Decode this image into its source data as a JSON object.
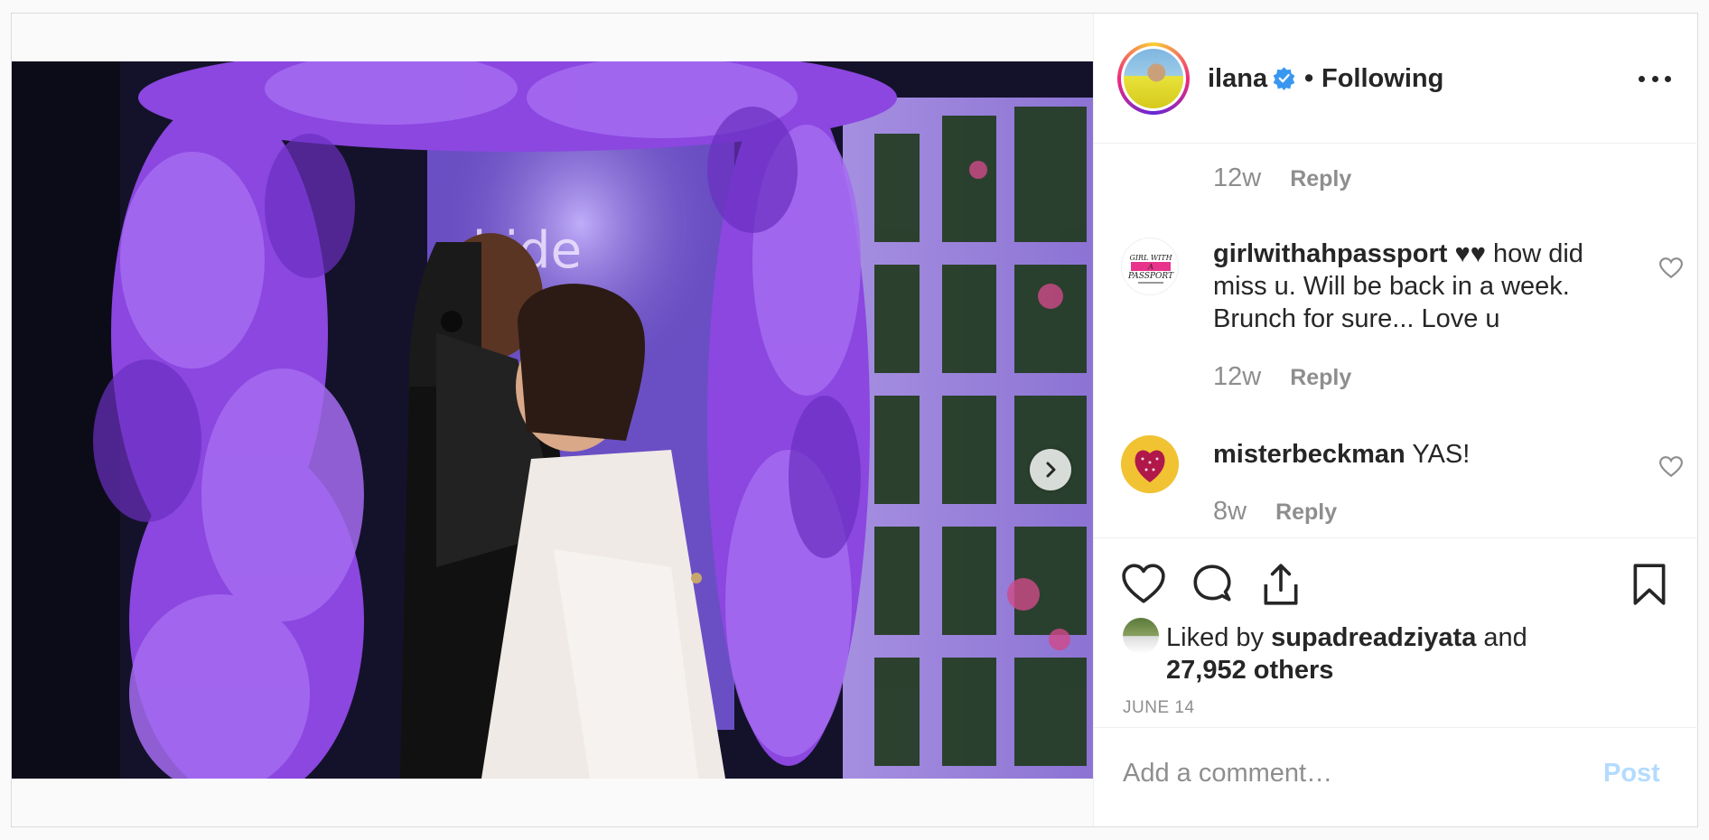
{
  "post": {
    "header": {
      "username": "ilana",
      "separator": "•",
      "follow_status": "Following",
      "verified": true
    },
    "comments": [
      {
        "id": "c0",
        "username": "",
        "text": "",
        "time": "12w",
        "reply_label": "Reply"
      },
      {
        "id": "c1",
        "username": "girlwithahpassport",
        "text": "♥♥ how did miss u. Will be back in a week. Brunch for sure... Love u",
        "time": "12w",
        "reply_label": "Reply",
        "avatar_text": "GIRL WITH A PASSPORT"
      },
      {
        "id": "c2",
        "username": "misterbeckman",
        "text": "YAS!",
        "time": "8w",
        "reply_label": "Reply"
      }
    ],
    "actions": {
      "icons": [
        "heart-icon",
        "comment-icon",
        "share-icon",
        "bookmark-icon"
      ]
    },
    "likes": {
      "prefix": "Liked by",
      "user": "supadreadziyata",
      "conjunction": "and",
      "others": "27,952 others"
    },
    "date": "JUNE 14",
    "add_comment": {
      "placeholder": "Add a comment…",
      "post_label": "Post"
    },
    "colors": {
      "text": "#262626",
      "secondary": "#8e8e8e",
      "verified": "#3897f0",
      "post_disabled": "#b3dbff",
      "border": "#dbdbdb"
    },
    "photo": {
      "sign_text": "hide"
    }
  }
}
